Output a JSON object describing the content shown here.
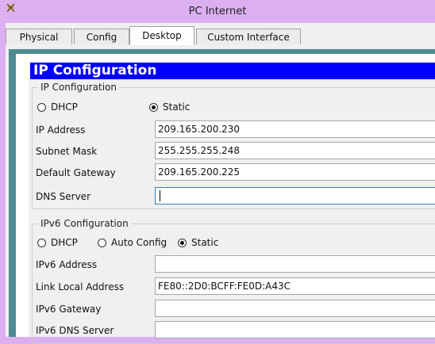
{
  "window": {
    "title": "PC Internet"
  },
  "tabs": [
    {
      "label": "Physical"
    },
    {
      "label": "Config"
    },
    {
      "label": "Desktop"
    },
    {
      "label": "Custom Interface"
    }
  ],
  "active_tab": "Desktop",
  "panel": {
    "title": "IP Configuration"
  },
  "ipv4": {
    "group_label": "IP Configuration",
    "mode_options": {
      "dhcp": "DHCP",
      "static": "Static"
    },
    "selected_mode": "Static",
    "fields": {
      "ip_address": {
        "label": "IP Address",
        "value": "209.165.200.230"
      },
      "subnet_mask": {
        "label": "Subnet Mask",
        "value": "255.255.255.248"
      },
      "default_gateway": {
        "label": "Default Gateway",
        "value": "209.165.200.225"
      },
      "dns_server": {
        "label": "DNS Server",
        "value": ""
      }
    }
  },
  "ipv6": {
    "group_label": "IPv6 Configuration",
    "mode_options": {
      "dhcp": "DHCP",
      "auto_config": "Auto Config",
      "static": "Static"
    },
    "selected_mode": "Static",
    "fields": {
      "ipv6_address": {
        "label": "IPv6 Address",
        "value": ""
      },
      "link_local_address": {
        "label": "Link Local Address",
        "value": "FE80::2D0:BCFF:FE0D:A43C"
      },
      "ipv6_gateway": {
        "label": "IPv6 Gateway",
        "value": ""
      },
      "ipv6_dns_server": {
        "label": "IPv6 DNS Server",
        "value": ""
      }
    }
  },
  "colors": {
    "title_bar": "#dcb0f0",
    "header_bar": "#0000ff",
    "frame_teal": "#4e8b92"
  }
}
